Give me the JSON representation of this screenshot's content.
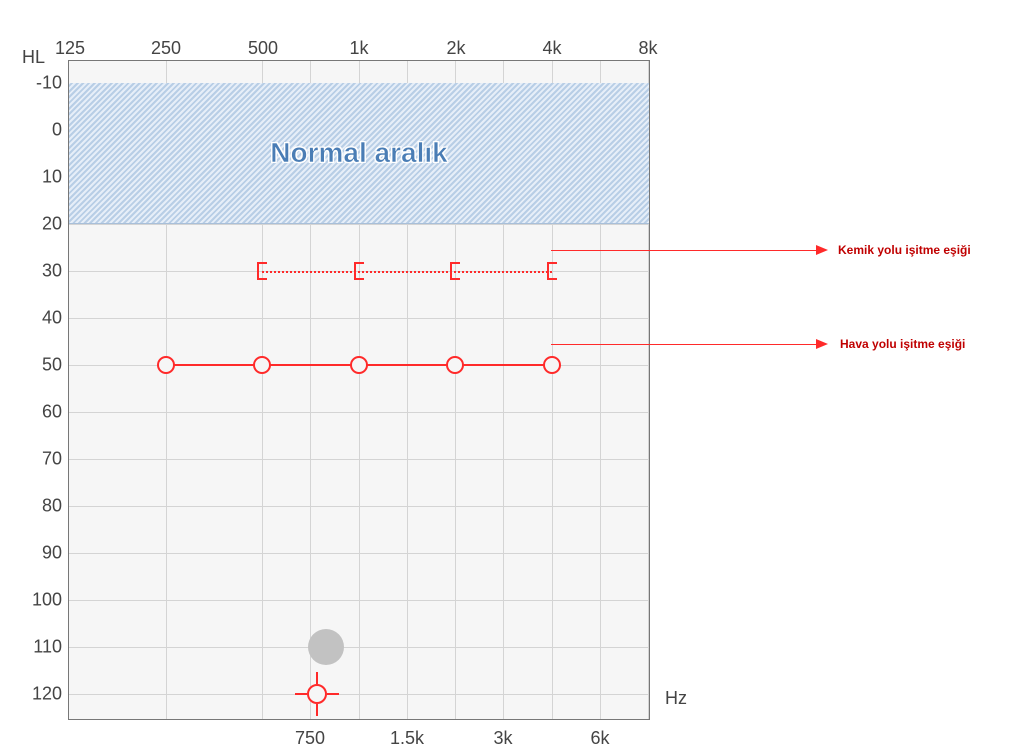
{
  "chart_data": {
    "type": "line",
    "title": "",
    "x_axis": {
      "label": "Hz",
      "major_ticks": [
        "125",
        "250",
        "500",
        "1k",
        "2k",
        "4k",
        "8k"
      ],
      "minor_ticks": [
        "750",
        "1.5k",
        "3k",
        "6k"
      ]
    },
    "y_axis": {
      "label": "HL",
      "ticks": [
        -10,
        0,
        10,
        20,
        30,
        40,
        50,
        60,
        70,
        80,
        90,
        100,
        110,
        120
      ],
      "range": [
        -10,
        120
      ]
    },
    "normal_range": {
      "label": "Normal aralık",
      "from": -10,
      "to": 20
    },
    "series": [
      {
        "name": "Kemik yolu işitme eşiği",
        "marker": "bracket",
        "linestyle": "dotted",
        "frequencies": [
          "500",
          "1k",
          "2k",
          "4k"
        ],
        "values": [
          30,
          30,
          30,
          30
        ]
      },
      {
        "name": "Hava yolu işitme eşiği",
        "marker": "circle",
        "linestyle": "solid",
        "frequencies": [
          "250",
          "500",
          "1k",
          "2k",
          "4k"
        ],
        "values": [
          50,
          50,
          50,
          50,
          50
        ]
      }
    ],
    "extra_markers": [
      {
        "type": "dot",
        "freq": "750",
        "value": 110
      },
      {
        "type": "crosshair",
        "freq": "750",
        "value": 120
      }
    ],
    "annotations": [
      {
        "text": "Kemik yolu işitme eşiği",
        "target_series": 0
      },
      {
        "text": "Hava yolu işitme eşiği",
        "target_series": 1
      }
    ]
  }
}
